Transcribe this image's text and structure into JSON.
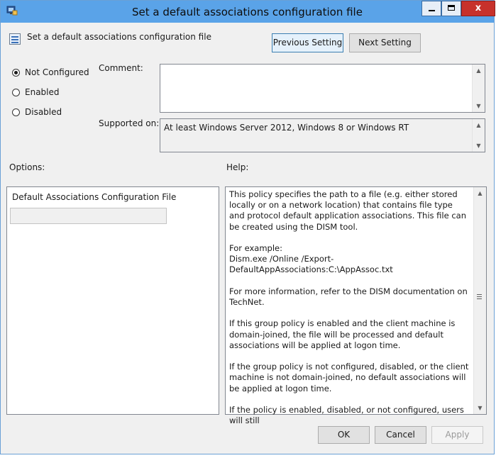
{
  "window": {
    "title": "Set a default associations configuration file"
  },
  "header": {
    "setting_title": "Set a default associations configuration file",
    "previous_label": "Previous Setting",
    "next_label": "Next Setting"
  },
  "state": {
    "options": [
      {
        "label": "Not Configured",
        "selected": true
      },
      {
        "label": "Enabled",
        "selected": false
      },
      {
        "label": "Disabled",
        "selected": false
      }
    ]
  },
  "comment": {
    "label": "Comment:",
    "value": ""
  },
  "supported": {
    "label": "Supported on:",
    "value": "At least Windows Server 2012, Windows 8 or Windows RT"
  },
  "options_panel": {
    "label": "Options:",
    "field_label": "Default Associations Configuration File",
    "field_value": ""
  },
  "help": {
    "label": "Help:",
    "text": "This policy specifies the path to a file (e.g. either stored locally or on a network location) that contains file type and protocol default application associations. This file can be created using the DISM tool.\n\nFor example:\nDism.exe /Online /Export-DefaultAppAssociations:C:\\AppAssoc.txt\n\nFor more information, refer to the DISM documentation on TechNet.\n\nIf this group policy is enabled and the client machine is domain-joined, the file will be processed and default associations will be applied at logon time.\n\nIf the group policy is not configured, disabled, or the client machine is not domain-joined, no default associations will be applied at logon time.\n\nIf the policy is enabled, disabled, or not configured, users will still"
  },
  "buttons": {
    "ok": "OK",
    "cancel": "Cancel",
    "apply": "Apply"
  },
  "window_controls": {
    "close_glyph": "x"
  },
  "colors": {
    "titlebar": "#5aa3e8",
    "close_button": "#c7312b",
    "dialog_bg": "#f0f0f0"
  }
}
